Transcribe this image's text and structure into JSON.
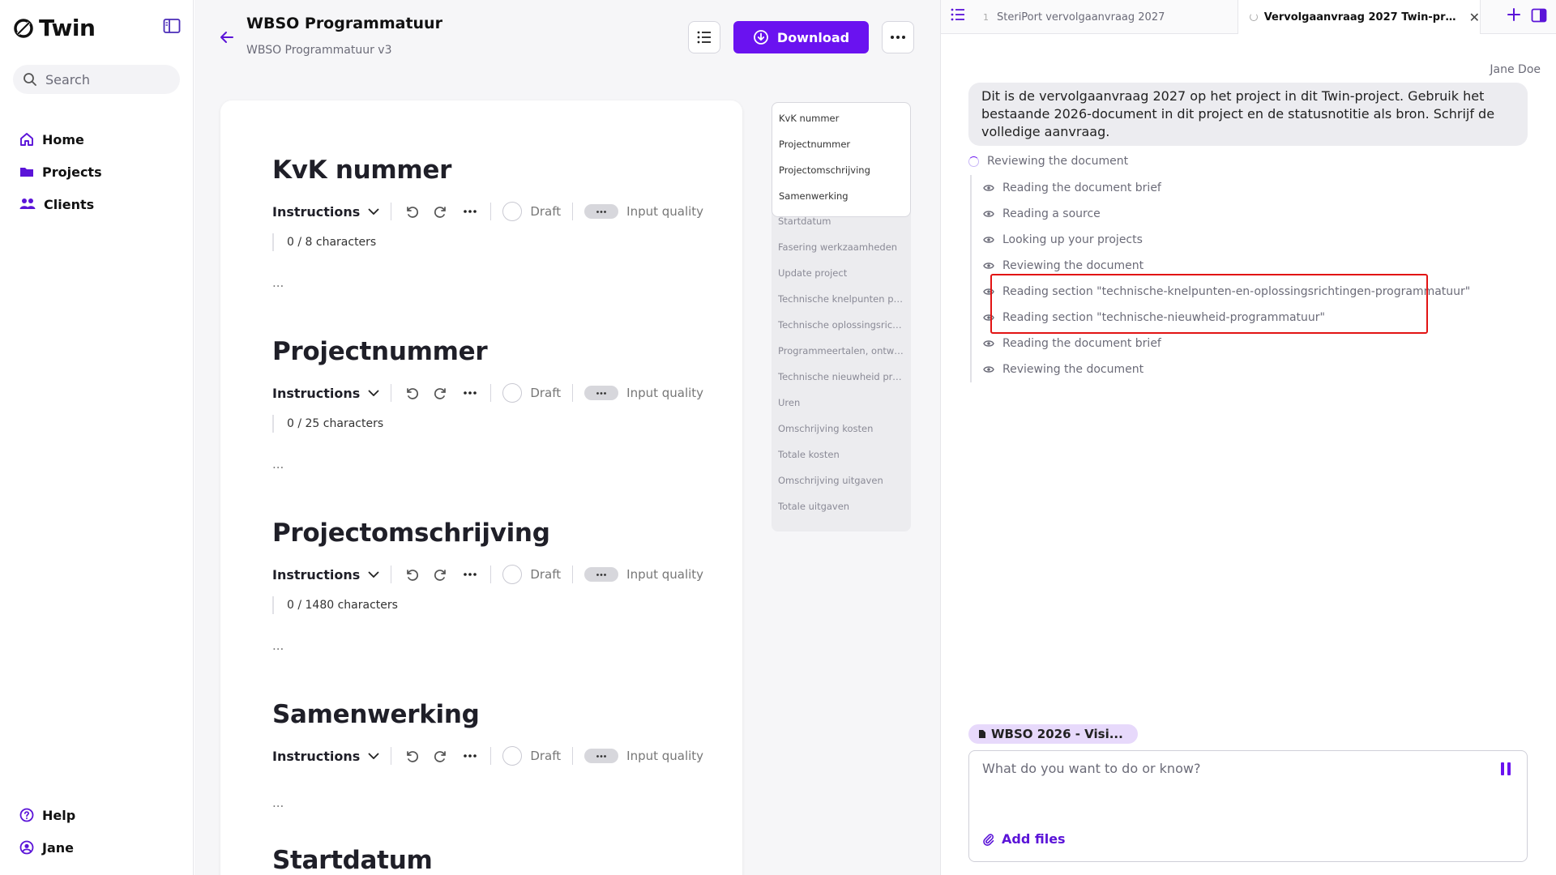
{
  "app": {
    "name": "Twin",
    "search_placeholder": "Search",
    "nav": [
      {
        "label": "Home",
        "icon": "home-icon"
      },
      {
        "label": "Projects",
        "icon": "folder-icon"
      },
      {
        "label": "Clients",
        "icon": "users-icon"
      }
    ],
    "nav_bottom": [
      {
        "label": "Help",
        "icon": "help-icon"
      },
      {
        "label": "Jane",
        "icon": "user-icon"
      }
    ]
  },
  "document": {
    "title": "WBSO Programmatuur",
    "subtitle": "WBSO Programmatuur v3",
    "download_label": "Download",
    "toolbar": {
      "instructions_label": "Instructions",
      "draft_label": "Draft",
      "quality_label": "Input quality"
    },
    "sections": [
      {
        "title": "KvK nummer",
        "count": "0 / 8 characters",
        "placeholder": "..."
      },
      {
        "title": "Projectnummer",
        "count": "0 / 25 characters",
        "placeholder": "..."
      },
      {
        "title": "Projectomschrijving",
        "count": "0 / 1480 characters",
        "placeholder": "..."
      },
      {
        "title": "Samenwerking",
        "count": "",
        "placeholder": "..."
      },
      {
        "title": "Startdatum",
        "count": "",
        "placeholder": ""
      }
    ],
    "outline_visible": [
      "KvK nummer",
      "Projectnummer",
      "Projectomschrijving",
      "Samenwerking"
    ],
    "outline_rest": [
      "Startdatum",
      "Fasering werkzaamheden",
      "Update project",
      "Technische knelpunten pro...",
      "Technische oplossingsricht...",
      "Programmeertalen, ontwik...",
      "Technische nieuwheid pro...",
      "Uren",
      "Omschrijving kosten",
      "Totale kosten",
      "Omschrijving uitgaven",
      "Totale uitgaven"
    ]
  },
  "chat": {
    "tabs": [
      {
        "num": "1",
        "label": "SteriPort vervolgaanvraag 2027"
      },
      {
        "label": "Vervolgaanvraag 2027 Twin-project op..."
      }
    ],
    "user_name": "Jane Doe",
    "user_message": "Dit is de vervolgaanvraag 2027 op het project in dit Twin-project. Gebruik het bestaande 2026-document in dit project en de statusnotitie als bron. Schrijf de volledige aanvraag.",
    "activity_header": "Reviewing the document",
    "activity_items": [
      "Reading the document brief",
      "Reading a source",
      "Looking up your projects",
      "Reviewing the document",
      "Reading section \"technische-knelpunten-en-oplossingsrichtingen-programmatuur\"",
      "Reading section \"technische-nieuwheid-programmatuur\"",
      "Reading the document brief",
      "Reviewing the document"
    ],
    "context_chip": "WBSO 2026 - Visi...",
    "composer_placeholder": "What do you want to do or know?",
    "add_files_label": "Add files"
  },
  "colors": {
    "accent": "#6a12f0",
    "highlight": "#e21414"
  }
}
